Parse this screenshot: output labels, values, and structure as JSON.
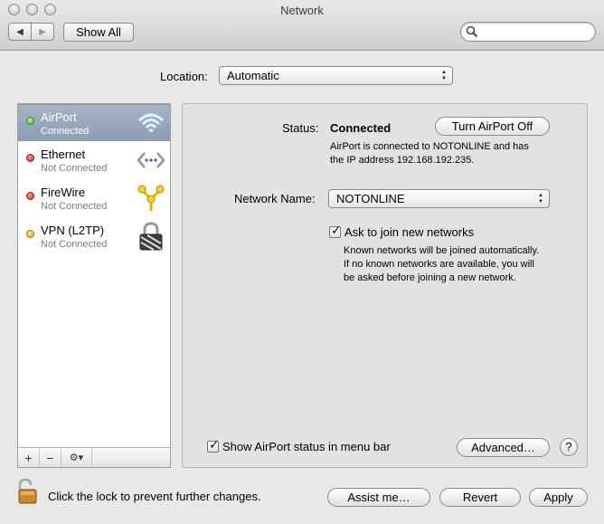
{
  "window": {
    "title": "Network"
  },
  "toolbar": {
    "back_icon": "back-arrow",
    "forward_icon": "forward-arrow",
    "show_all_label": "Show All",
    "search_placeholder": ""
  },
  "location": {
    "label": "Location:",
    "value": "Automatic"
  },
  "sidebar": {
    "services": [
      {
        "name": "AirPort",
        "status": "Connected",
        "status_color": "#5ab531",
        "icon": "wifi-icon",
        "selected": true
      },
      {
        "name": "Ethernet",
        "status": "Not Connected",
        "status_color": "#d9261c",
        "icon": "ethernet-icon",
        "selected": false
      },
      {
        "name": "FireWire",
        "status": "Not Connected",
        "status_color": "#d9261c",
        "icon": "firewire-icon",
        "selected": false
      },
      {
        "name": "VPN (L2TP)",
        "status": "Not Connected",
        "status_color": "#f0a81e",
        "icon": "vpn-lock-icon",
        "selected": false
      }
    ],
    "add_label": "+",
    "remove_label": "−",
    "action_label": "⚙▾"
  },
  "detail": {
    "status_label": "Status:",
    "status_value": "Connected",
    "toggle_button": "Turn AirPort Off",
    "status_desc_line1": "AirPort is connected to NOTONLINE and has",
    "status_desc_line2": "the IP address 192.168.192.235.",
    "network_name_label": "Network Name:",
    "network_name_value": "NOTONLINE",
    "ask_join_label": "Ask to join new networks",
    "ask_join_checked": true,
    "ask_desc_line1": "Known networks will be joined automatically.",
    "ask_desc_line2": "If no known networks are available, you will",
    "ask_desc_line3": "be asked before joining a new network.",
    "show_status_label": "Show AirPort status in menu bar",
    "show_status_checked": true,
    "advanced_button": "Advanced…",
    "help_label": "?"
  },
  "footer": {
    "lock_text": "Click the lock to prevent further changes.",
    "assist_button": "Assist me…",
    "revert_button": "Revert",
    "apply_button": "Apply"
  }
}
